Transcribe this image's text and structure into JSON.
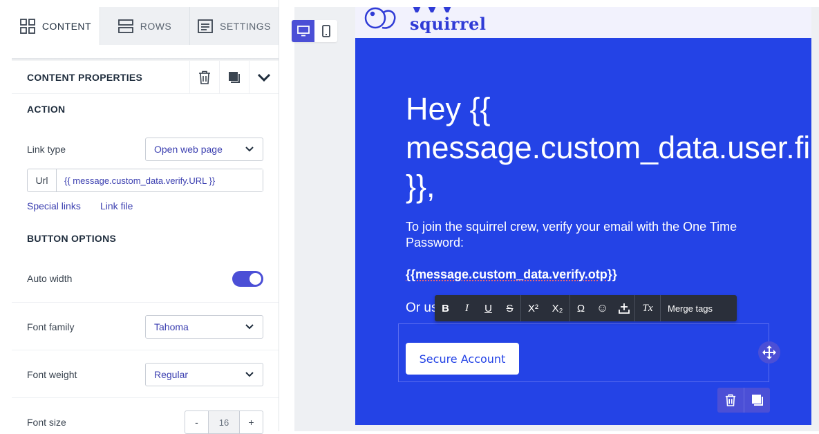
{
  "tabs": [
    {
      "label": "CONTENT",
      "icon": "grid-icon",
      "active": true
    },
    {
      "label": "ROWS",
      "icon": "rows-icon",
      "active": false
    },
    {
      "label": "SETTINGS",
      "icon": "settings-list-icon",
      "active": false
    }
  ],
  "properties": {
    "title": "CONTENT PROPERTIES",
    "action_title": "ACTION",
    "link_type_label": "Link type",
    "link_type_value": "Open web page",
    "url_label": "Url",
    "url_value": "{{ message.custom_data.verify.URL }}",
    "special_links": "Special links",
    "link_file": "Link file",
    "button_options_title": "BUTTON OPTIONS",
    "auto_width_label": "Auto width",
    "auto_width_on": true,
    "font_family_label": "Font family",
    "font_family_value": "Tahoma",
    "font_weight_label": "Font weight",
    "font_weight_value": "Regular",
    "font_size_label": "Font size",
    "font_size_value": "16",
    "minus": "-",
    "plus": "+"
  },
  "logo": {
    "text": "squirrel"
  },
  "email": {
    "headline": "Hey {{\nmessage.custom_data.user.fi\n}},",
    "paragraph": "To join the squirrel crew, verify your email with the One Time Password:",
    "otp": "{{message.custom_data.verify.otp}}",
    "or_text": "Or us",
    "button_label": "Secure Account"
  },
  "toolbar": {
    "merge_tags": "Merge tags",
    "bold": "B",
    "italic": "I",
    "underline": "U",
    "strike": "S",
    "superscript": "X²",
    "subscript": "X₂",
    "omega": "Ω",
    "emoji": "☺",
    "clear": "Tx"
  },
  "colors": {
    "accent": "#4b4fd6",
    "email_bg": "#2443e6",
    "toolbar_bg": "#2a2f3a"
  }
}
